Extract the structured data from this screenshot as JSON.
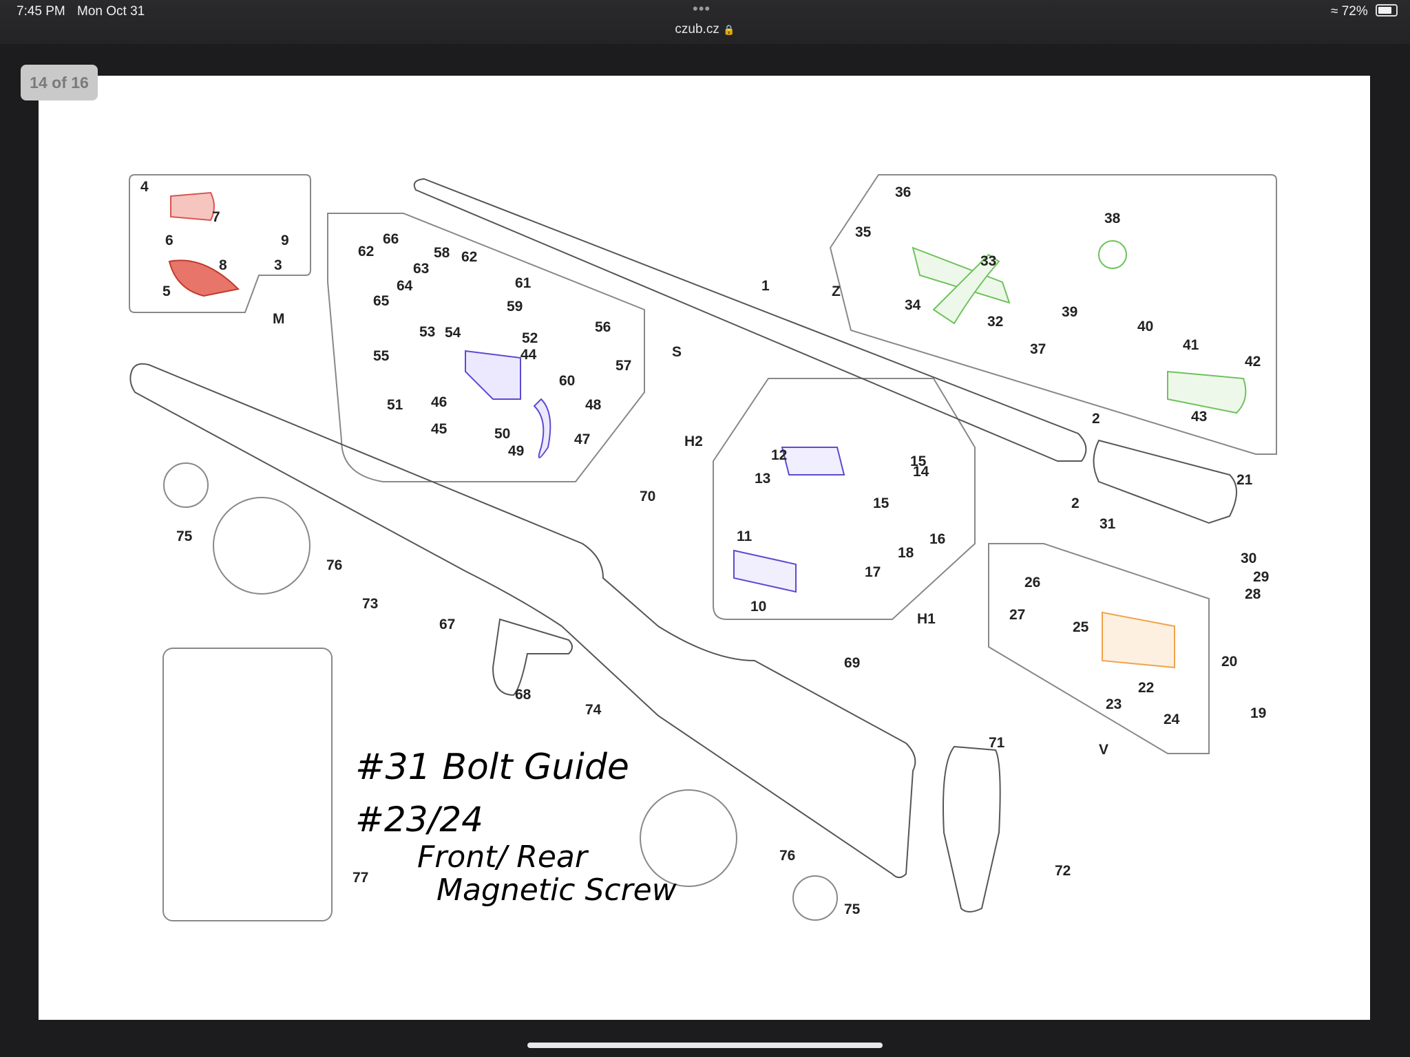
{
  "status_bar": {
    "time": "7:45 PM",
    "date": "Mon Oct 31",
    "more_dots": "•••",
    "url": "czub.cz",
    "battery": "72%"
  },
  "page_counter": "14 of 16",
  "groups": {
    "M": "M",
    "S": "S",
    "Z": "Z",
    "H2": "H2",
    "H1": "H1",
    "V": "V"
  },
  "part_labels": [
    "1",
    "2",
    "3",
    "4",
    "5",
    "6",
    "7",
    "8",
    "9",
    "10",
    "11",
    "12",
    "13",
    "14",
    "15",
    "16",
    "17",
    "18",
    "19",
    "20",
    "21",
    "22",
    "23",
    "24",
    "25",
    "26",
    "27",
    "28",
    "29",
    "30",
    "31",
    "32",
    "33",
    "34",
    "35",
    "36",
    "37",
    "38",
    "39",
    "40",
    "41",
    "42",
    "43",
    "44",
    "45",
    "46",
    "47",
    "48",
    "49",
    "50",
    "51",
    "52",
    "53",
    "54",
    "55",
    "56",
    "57",
    "58",
    "59",
    "60",
    "61",
    "62",
    "63",
    "64",
    "65",
    "66",
    "67",
    "68",
    "69",
    "70",
    "71",
    "72",
    "73",
    "74",
    "75",
    "76",
    "77"
  ],
  "handwritten_note": {
    "line1": "#31 Bolt Guide",
    "line2": "#23/24",
    "line3": "Front/ Rear",
    "line4": "Magnetic Screw"
  },
  "colors": {
    "trigger_group": "#5a4ad1",
    "bolt_group": "#6cc35a",
    "safety_group": "#e0503c",
    "magazine_group": "#f0a34a"
  }
}
